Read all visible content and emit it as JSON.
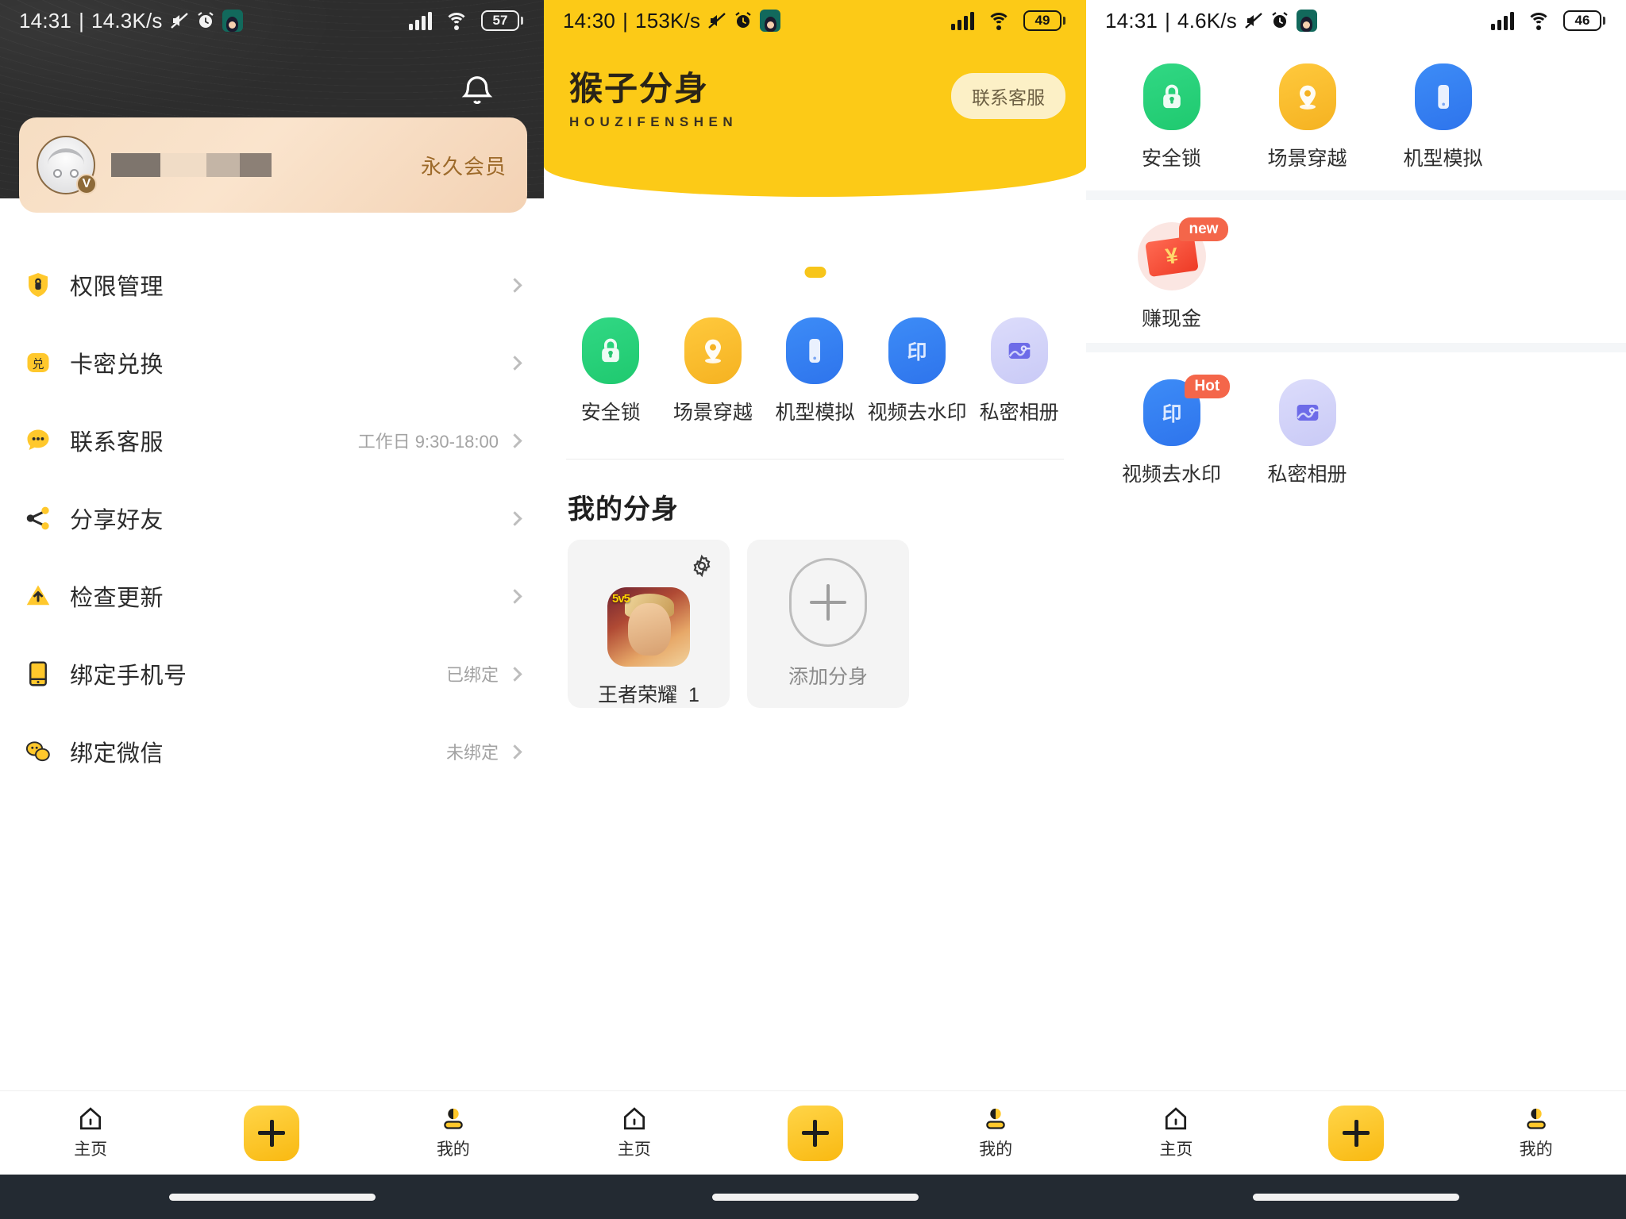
{
  "app": {
    "name_cn": "猴子分身",
    "name_en": "HOUZIFENSHEN"
  },
  "panel1": {
    "statusbar": {
      "time": "14:31",
      "separator": "|",
      "net_speed": "14.3K/s",
      "icons": [
        "mute-icon",
        "alarm-icon",
        "avatar-icon"
      ],
      "right_icons": [
        "signal-icon",
        "wifi-icon",
        "battery-icon"
      ],
      "battery": "57"
    },
    "notification_icon": "bell-icon",
    "user_card": {
      "vip_label": "永久会员",
      "avatar_badge": "V"
    },
    "menu": [
      {
        "icon": "shield-lock-icon",
        "label": "权限管理",
        "value": ""
      },
      {
        "icon": "redeem-icon",
        "label": "卡密兑换",
        "value": ""
      },
      {
        "icon": "chat-support-icon",
        "label": "联系客服",
        "value": "工作日 9:30-18:00"
      },
      {
        "icon": "share-icon",
        "label": "分享好友",
        "value": ""
      },
      {
        "icon": "cloud-update-icon",
        "label": "检查更新",
        "value": ""
      },
      {
        "icon": "phone-icon",
        "label": "绑定手机号",
        "value": "已绑定"
      },
      {
        "icon": "wechat-icon",
        "label": "绑定微信",
        "value": "未绑定"
      }
    ],
    "bottomnav": [
      {
        "icon": "home-icon",
        "label": "主页"
      },
      {
        "icon": "plus-icon",
        "label": ""
      },
      {
        "icon": "user-icon",
        "label": "我的"
      }
    ]
  },
  "panel2": {
    "statusbar": {
      "time": "14:30",
      "separator": "|",
      "net_speed": "153K/s",
      "battery": "49"
    },
    "support_button": "联系客服",
    "features": [
      {
        "icon": "lock-icon",
        "label": "安全锁"
      },
      {
        "icon": "location-icon",
        "label": "场景穿越"
      },
      {
        "icon": "device-icon",
        "label": "机型模拟"
      },
      {
        "icon": "watermark-icon",
        "label": "视频去水印"
      },
      {
        "icon": "album-icon",
        "label": "私密相册"
      }
    ],
    "section_title": "我的分身",
    "apps": [
      {
        "name": "王者荣耀",
        "count": "1",
        "gear_icon": "gear-icon"
      }
    ],
    "add_clone_label": "添加分身",
    "bottomnav": [
      {
        "icon": "home-icon",
        "label": "主页"
      },
      {
        "icon": "plus-icon",
        "label": ""
      },
      {
        "icon": "user-icon",
        "label": "我的"
      }
    ]
  },
  "panel3": {
    "statusbar": {
      "time": "14:31",
      "separator": "|",
      "net_speed": "4.6K/s",
      "battery": "46"
    },
    "row1": [
      {
        "icon": "lock-icon",
        "label": "安全锁",
        "badge": ""
      },
      {
        "icon": "location-icon",
        "label": "场景穿越",
        "badge": ""
      },
      {
        "icon": "device-icon",
        "label": "机型模拟",
        "badge": ""
      }
    ],
    "row2": [
      {
        "icon": "cash-icon",
        "label": "赚现金",
        "badge": "new"
      }
    ],
    "row3": [
      {
        "icon": "watermark-icon",
        "label": "视频去水印",
        "badge": "Hot"
      },
      {
        "icon": "album-icon",
        "label": "私密相册",
        "badge": ""
      }
    ],
    "bottomnav": [
      {
        "icon": "home-icon",
        "label": "主页"
      },
      {
        "icon": "plus-icon",
        "label": ""
      },
      {
        "icon": "user-icon",
        "label": "我的"
      }
    ]
  },
  "colors": {
    "brand_yellow": "#FCCA17",
    "accent_green": "#2FD07E",
    "accent_blue": "#3380F5",
    "badge_red": "#F4664A",
    "vip_text": "#9D6A2A"
  }
}
